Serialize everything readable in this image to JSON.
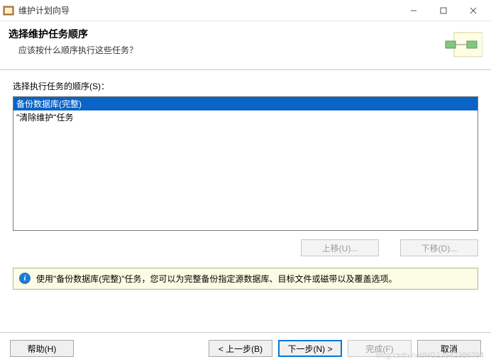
{
  "window": {
    "title": "维护计划向导"
  },
  "header": {
    "heading": "选择维护任务顺序",
    "subheading": "应该按什么顺序执行这些任务？"
  },
  "list": {
    "label": "选择执行任务的顺序(S)：",
    "items": [
      {
        "label": "备份数据库(完整)",
        "selected": true
      },
      {
        "label": "\"清除维护\"任务",
        "selected": false
      }
    ]
  },
  "buttons": {
    "move_up": "上移(U)...",
    "move_down": "下移(D)...",
    "help": "帮助(H)",
    "back": "< 上一步(B)",
    "next": "下一步(N) >",
    "finish": "完成(F)",
    "cancel": "取消"
  },
  "info": {
    "text": "使用\"备份数据库(完整)\"任务，您可以为完整备份指定源数据库、目标文件或磁带以及覆盖选项。"
  },
  "watermark": "blog.csdn.net/HG13542386794"
}
